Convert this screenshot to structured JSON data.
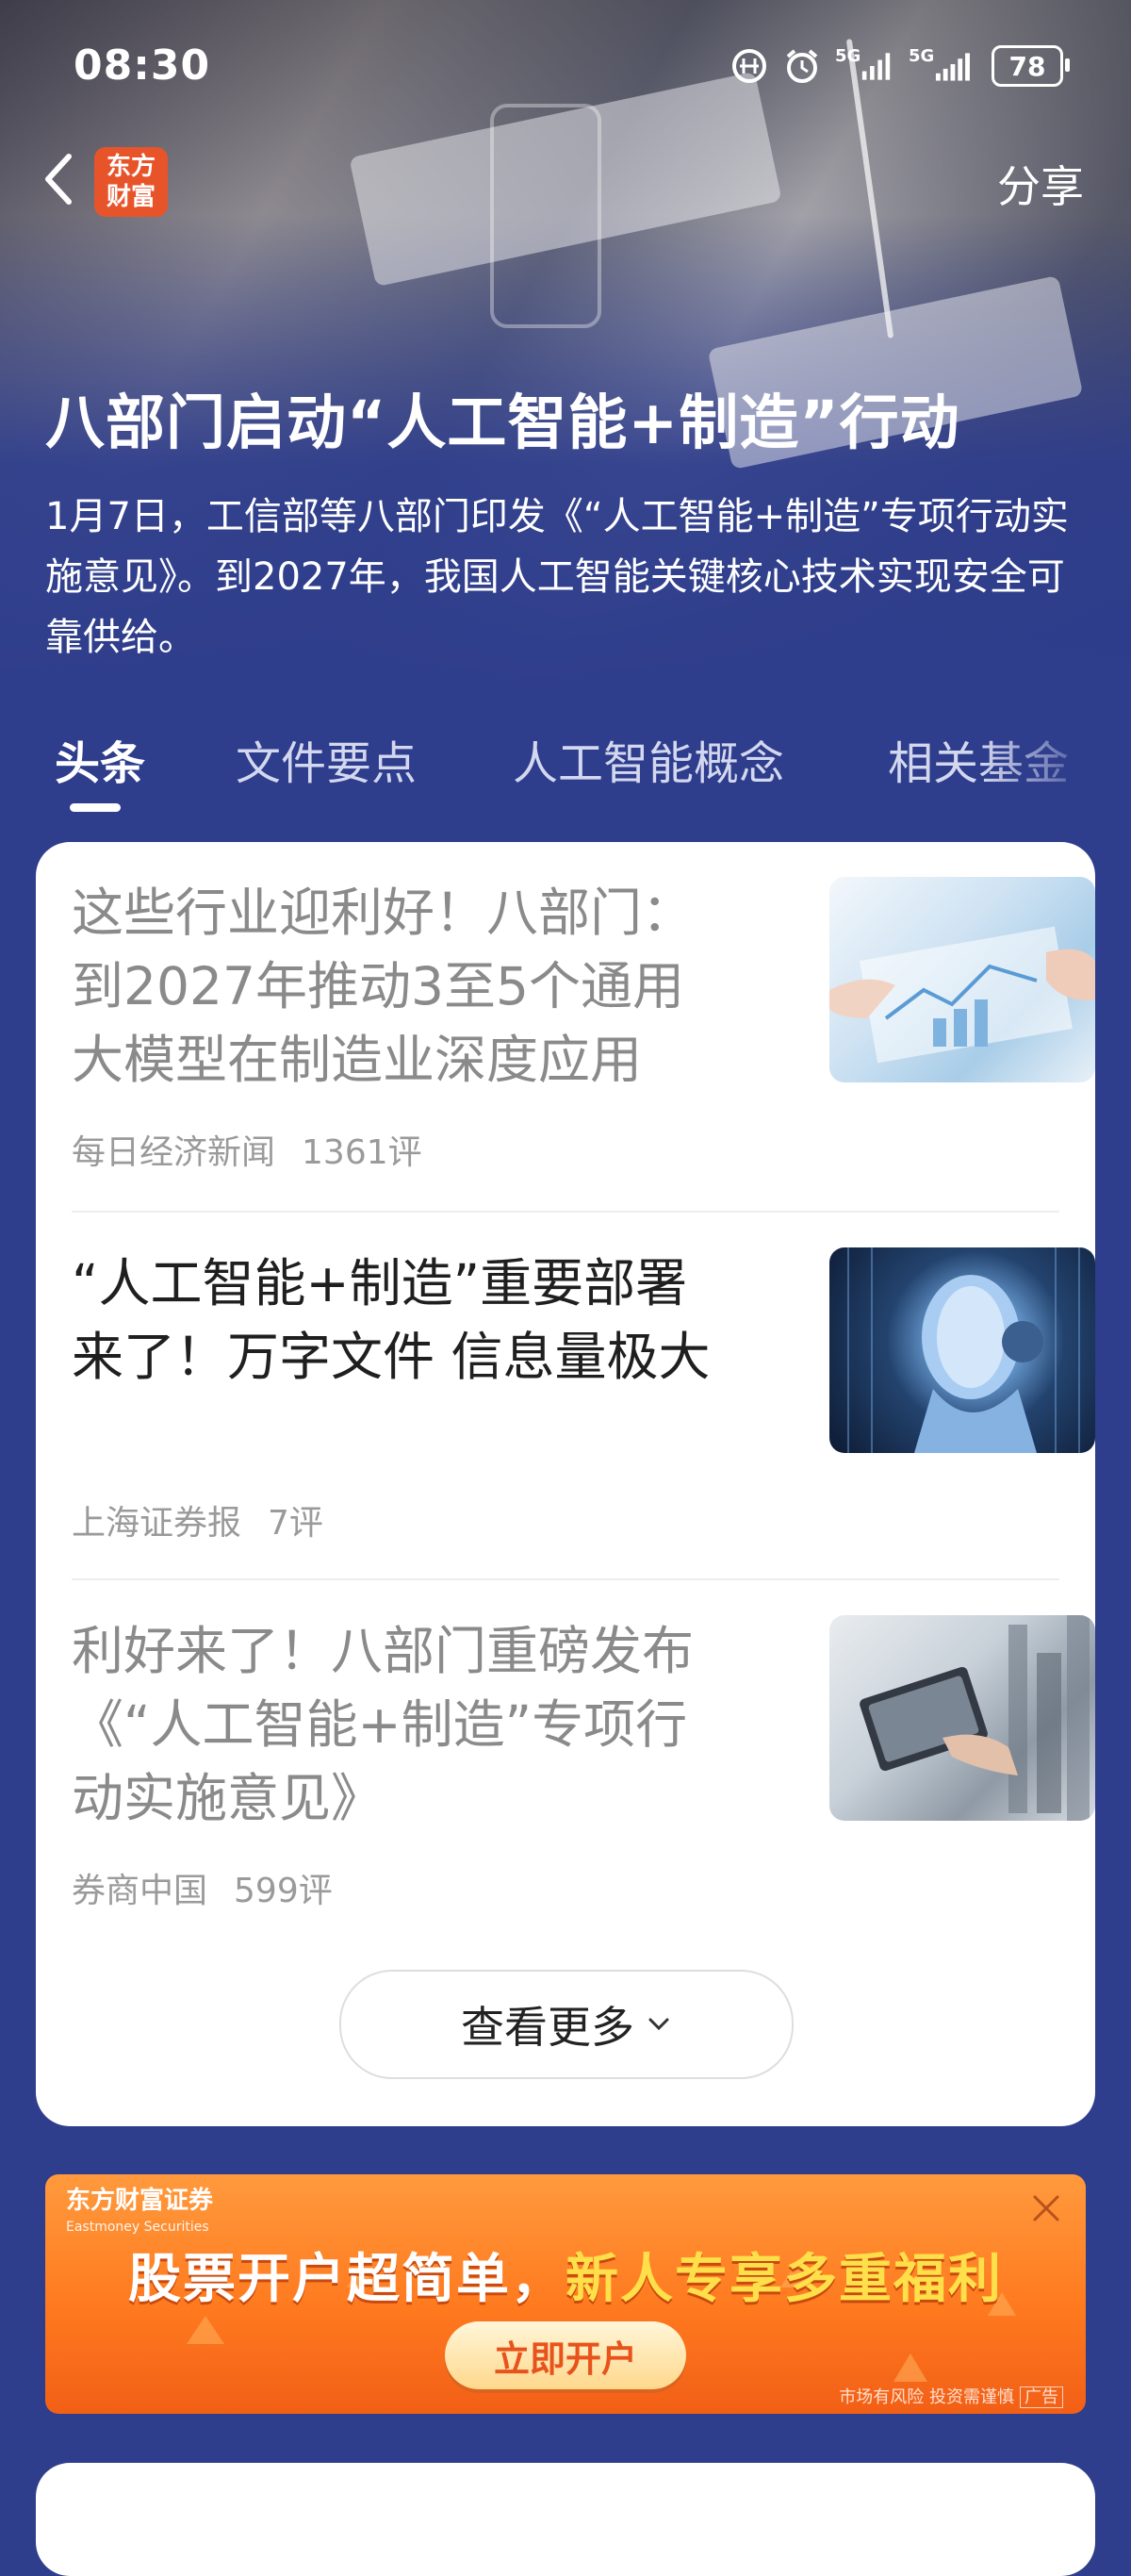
{
  "status_bar": {
    "time": "08:30",
    "network_1": "5G",
    "network_2": "5G",
    "battery": "78"
  },
  "header": {
    "logo_line1": "东方",
    "logo_line2": "财富",
    "share_label": "分享"
  },
  "topic": {
    "title": "八部门启动“人工智能+制造”行动",
    "summary": "1月7日，工信部等八部门印发《“人工智能+制造”专项行动实施意见》。到2027年，我国人工智能关键核心技术实现安全可靠供给。"
  },
  "tabs": [
    {
      "label": "头条",
      "active": true
    },
    {
      "label": "文件要点",
      "active": false
    },
    {
      "label": "人工智能概念",
      "active": false
    },
    {
      "label": "相关基金",
      "active": false
    }
  ],
  "news": [
    {
      "title": "这些行业迎利好！八部门：到2027年推动3至5个通用大模型在制造业深度应用",
      "source": "每日经济新闻",
      "comments": "1361评",
      "read": true
    },
    {
      "title": "“人工智能+制造”重要部署来了！万字文件 信息量极大",
      "source": "上海证券报",
      "comments": "7评",
      "read": false
    },
    {
      "title": "利好来了！八部门重磅发布《“人工智能+制造”专项行动实施意见》",
      "source": "券商中国",
      "comments": "599评",
      "read": true
    }
  ],
  "more_label": "查看更多",
  "ad": {
    "brand": "东方财富证券",
    "brand_en": "Eastmoney Securities",
    "headline_part1": "股票开户超简单，",
    "headline_part2": "新人专享多重福利",
    "cta": "立即开户",
    "disclaimer": "市场有风险 投资需谨慎",
    "ad_tag": "广告"
  }
}
